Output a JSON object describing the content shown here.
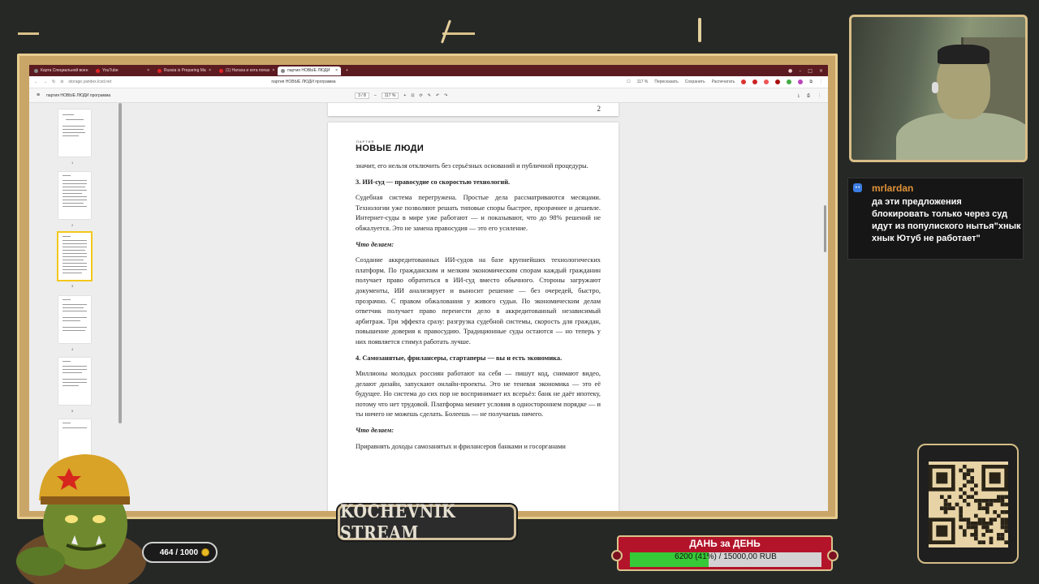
{
  "browser": {
    "tabs": [
      {
        "label": "Карта Специальной воен",
        "active": false
      },
      {
        "label": "YouTube",
        "active": false
      },
      {
        "label": "Russia is Preparing Ma",
        "active": false
      },
      {
        "label": "(1) Натаха и кота попах",
        "active": false
      },
      {
        "label": "партия НОВЫЕ ЛЮДИ",
        "active": true
      }
    ],
    "url": "storage.yandex.lcsd.net",
    "page_title": "партия НОВЫЕ ЛЮДИ программа",
    "zoom": "117 %",
    "retell": "Пересказать",
    "save": "Сохранить",
    "recognize": "Распечатать"
  },
  "pdf": {
    "doc_title": "партия НОВЫЕ ЛЮДИ программа",
    "page_indicator": "3 / 8",
    "zoom": "117 %",
    "prev_page_number": "2",
    "thumb_numbers": [
      "1",
      "2",
      "3",
      "4",
      "5"
    ],
    "logo_small": "ПАРТИЯ",
    "logo_big": "НОВЫЕ ЛЮДИ",
    "paragraphs": [
      {
        "type": "p",
        "text": "значит, его нельзя отключить без серьёзных оснований и публичной процедуры."
      },
      {
        "type": "h",
        "text": "3.   ИИ-суд — правосудие со скоростью технологий."
      },
      {
        "type": "p",
        "text": "Судебная система перегружена. Простые дела рассматриваются месяцами. Технологии уже позволяют решать типовые споры быстрее, прозрачнее и дешевле. Интернет-суды в мире уже работают — и показывают, что до 98% решений не обжалуется. Это не замена правосудия — это его усиление."
      },
      {
        "type": "sub",
        "text": "Что делаем:"
      },
      {
        "type": "p",
        "text": "Создание аккредитованных ИИ-судов на базе крупнейших технологических платформ. По гражданским и мелким экономическим спорам каждый гражданин получает право обратиться в ИИ-суд вместо обычного. Стороны загружают документы, ИИ анализирует и выносит решение — без очередей, быстро, прозрачно. С правом обжалования у живого судьи. По экономическим делам ответчик получает право перенести дело в аккредитованный независимый арбитраж. Три эффекта сразу: разгрузка судебной системы, скорость для граждан, повышение доверия к правосудию. Традиционные суды остаются — но теперь у них появляется стимул работать лучше."
      },
      {
        "type": "h",
        "text": "4.   Самозанятые, фрилансеры, стартаперы — вы и есть экономика."
      },
      {
        "type": "p",
        "text": "Миллионы молодых россиян работают на себя — пишут код, снимают видео, делают дизайн, запускают онлайн-проекты. Это не теневая экономика — это её будущее. Но система до сих пор не воспринимает их всерьёз: банк не даёт ипотеку, потому что нет трудовой. Платформа меняет условия в одностороннем порядке — и ты ничего не можешь сделать. Болеешь — не получаешь ничего."
      },
      {
        "type": "sub",
        "text": "Что делаем:"
      },
      {
        "type": "p",
        "text": "Приравнять доходы самозанятых и фрилансеров банками и госорганами"
      }
    ]
  },
  "chat": {
    "username": "mrlardan",
    "badge": "••",
    "message": "да эти предложения блокировать только через суд идут из популиского нытья\"хнык хнык Ютуб не работает\""
  },
  "xp": {
    "text": "464 / 1000",
    "current": 464,
    "max": 1000
  },
  "banner": {
    "text": "KOCHEVNIK STREAM"
  },
  "goal": {
    "title": "ДАНЬ за ДЕНЬ",
    "text": "6200 (41%) / 15000,00 RUB",
    "percent": 41,
    "fill_color": "#36c938"
  }
}
